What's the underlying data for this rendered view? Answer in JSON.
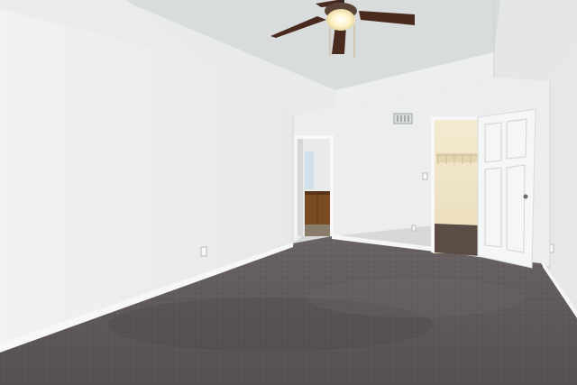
{
  "scene": {
    "subject": "empty-bedroom-interior",
    "colors": {
      "wall": "#eceeee",
      "wall_shadow": "#e2e4e5",
      "ceiling": "#e4e6e7",
      "tray_ceiling": "#d9dcdd",
      "carpet": "#5f5858",
      "baseboard": "#f7f7f7",
      "door": "#f5f6f6",
      "closet_wall": "#efe4c8",
      "wood_cabinet": "#7a4a22",
      "fan_blade": "#4a2a1f",
      "fan_light": "#fff7d8"
    }
  }
}
